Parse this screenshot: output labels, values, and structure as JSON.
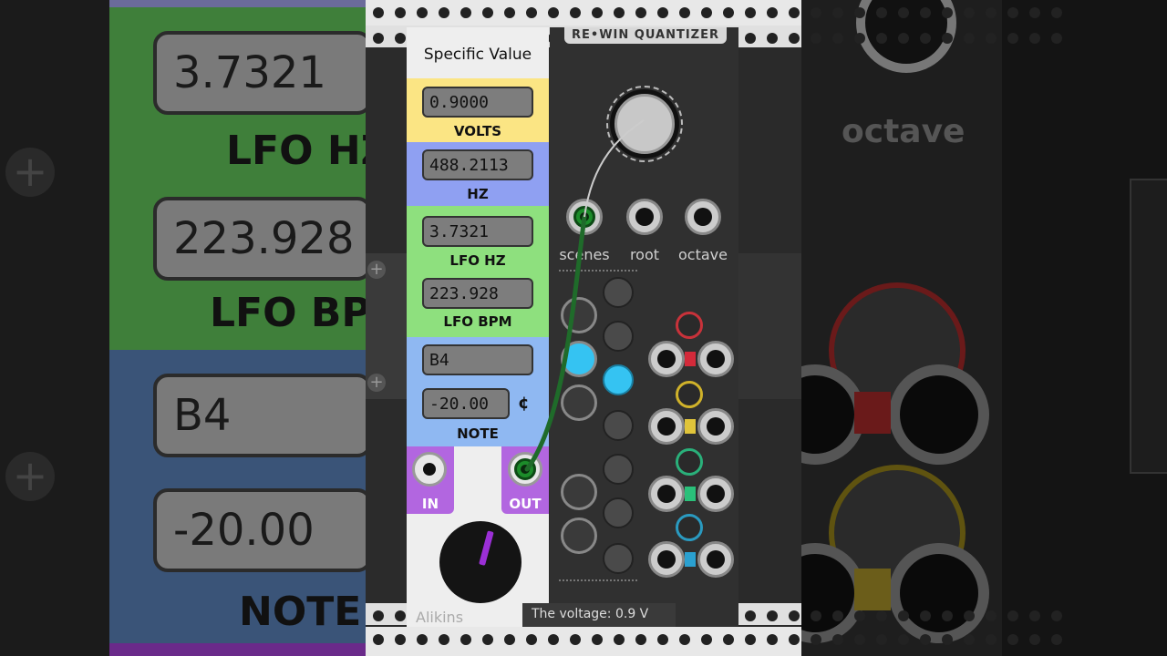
{
  "specific_value": {
    "title": "Specific Value",
    "volts": {
      "value": "0.9000",
      "label": "VOLTS"
    },
    "hz": {
      "value": "488.2113",
      "label": "HZ"
    },
    "lfo_hz": {
      "value": "3.7321",
      "label": "LFO HZ"
    },
    "lfo_bpm": {
      "value": "223.928",
      "label": "LFO BPM"
    },
    "note": {
      "value": "B4",
      "cents": "-20.00",
      "cents_symbol": "¢",
      "label": "NOTE"
    },
    "in_label": "IN",
    "out_label": "OUT",
    "brand": "Alikins"
  },
  "quantizer": {
    "title": "RE•WIN QUANTIZER",
    "jack_labels": [
      "scenes",
      "root",
      "octave"
    ]
  },
  "tooltip": "The voltage: 0.9 V",
  "background_right": {
    "label": "octave"
  },
  "colors": {
    "volts_band": "#fbe584",
    "hz_band": "#8fa0f2",
    "lfo_band": "#8ee07e",
    "note_band": "#8fb8f2",
    "io_band": "#b266e0",
    "cable": "#1f6b2a",
    "led_blue": "#35c3f2"
  }
}
